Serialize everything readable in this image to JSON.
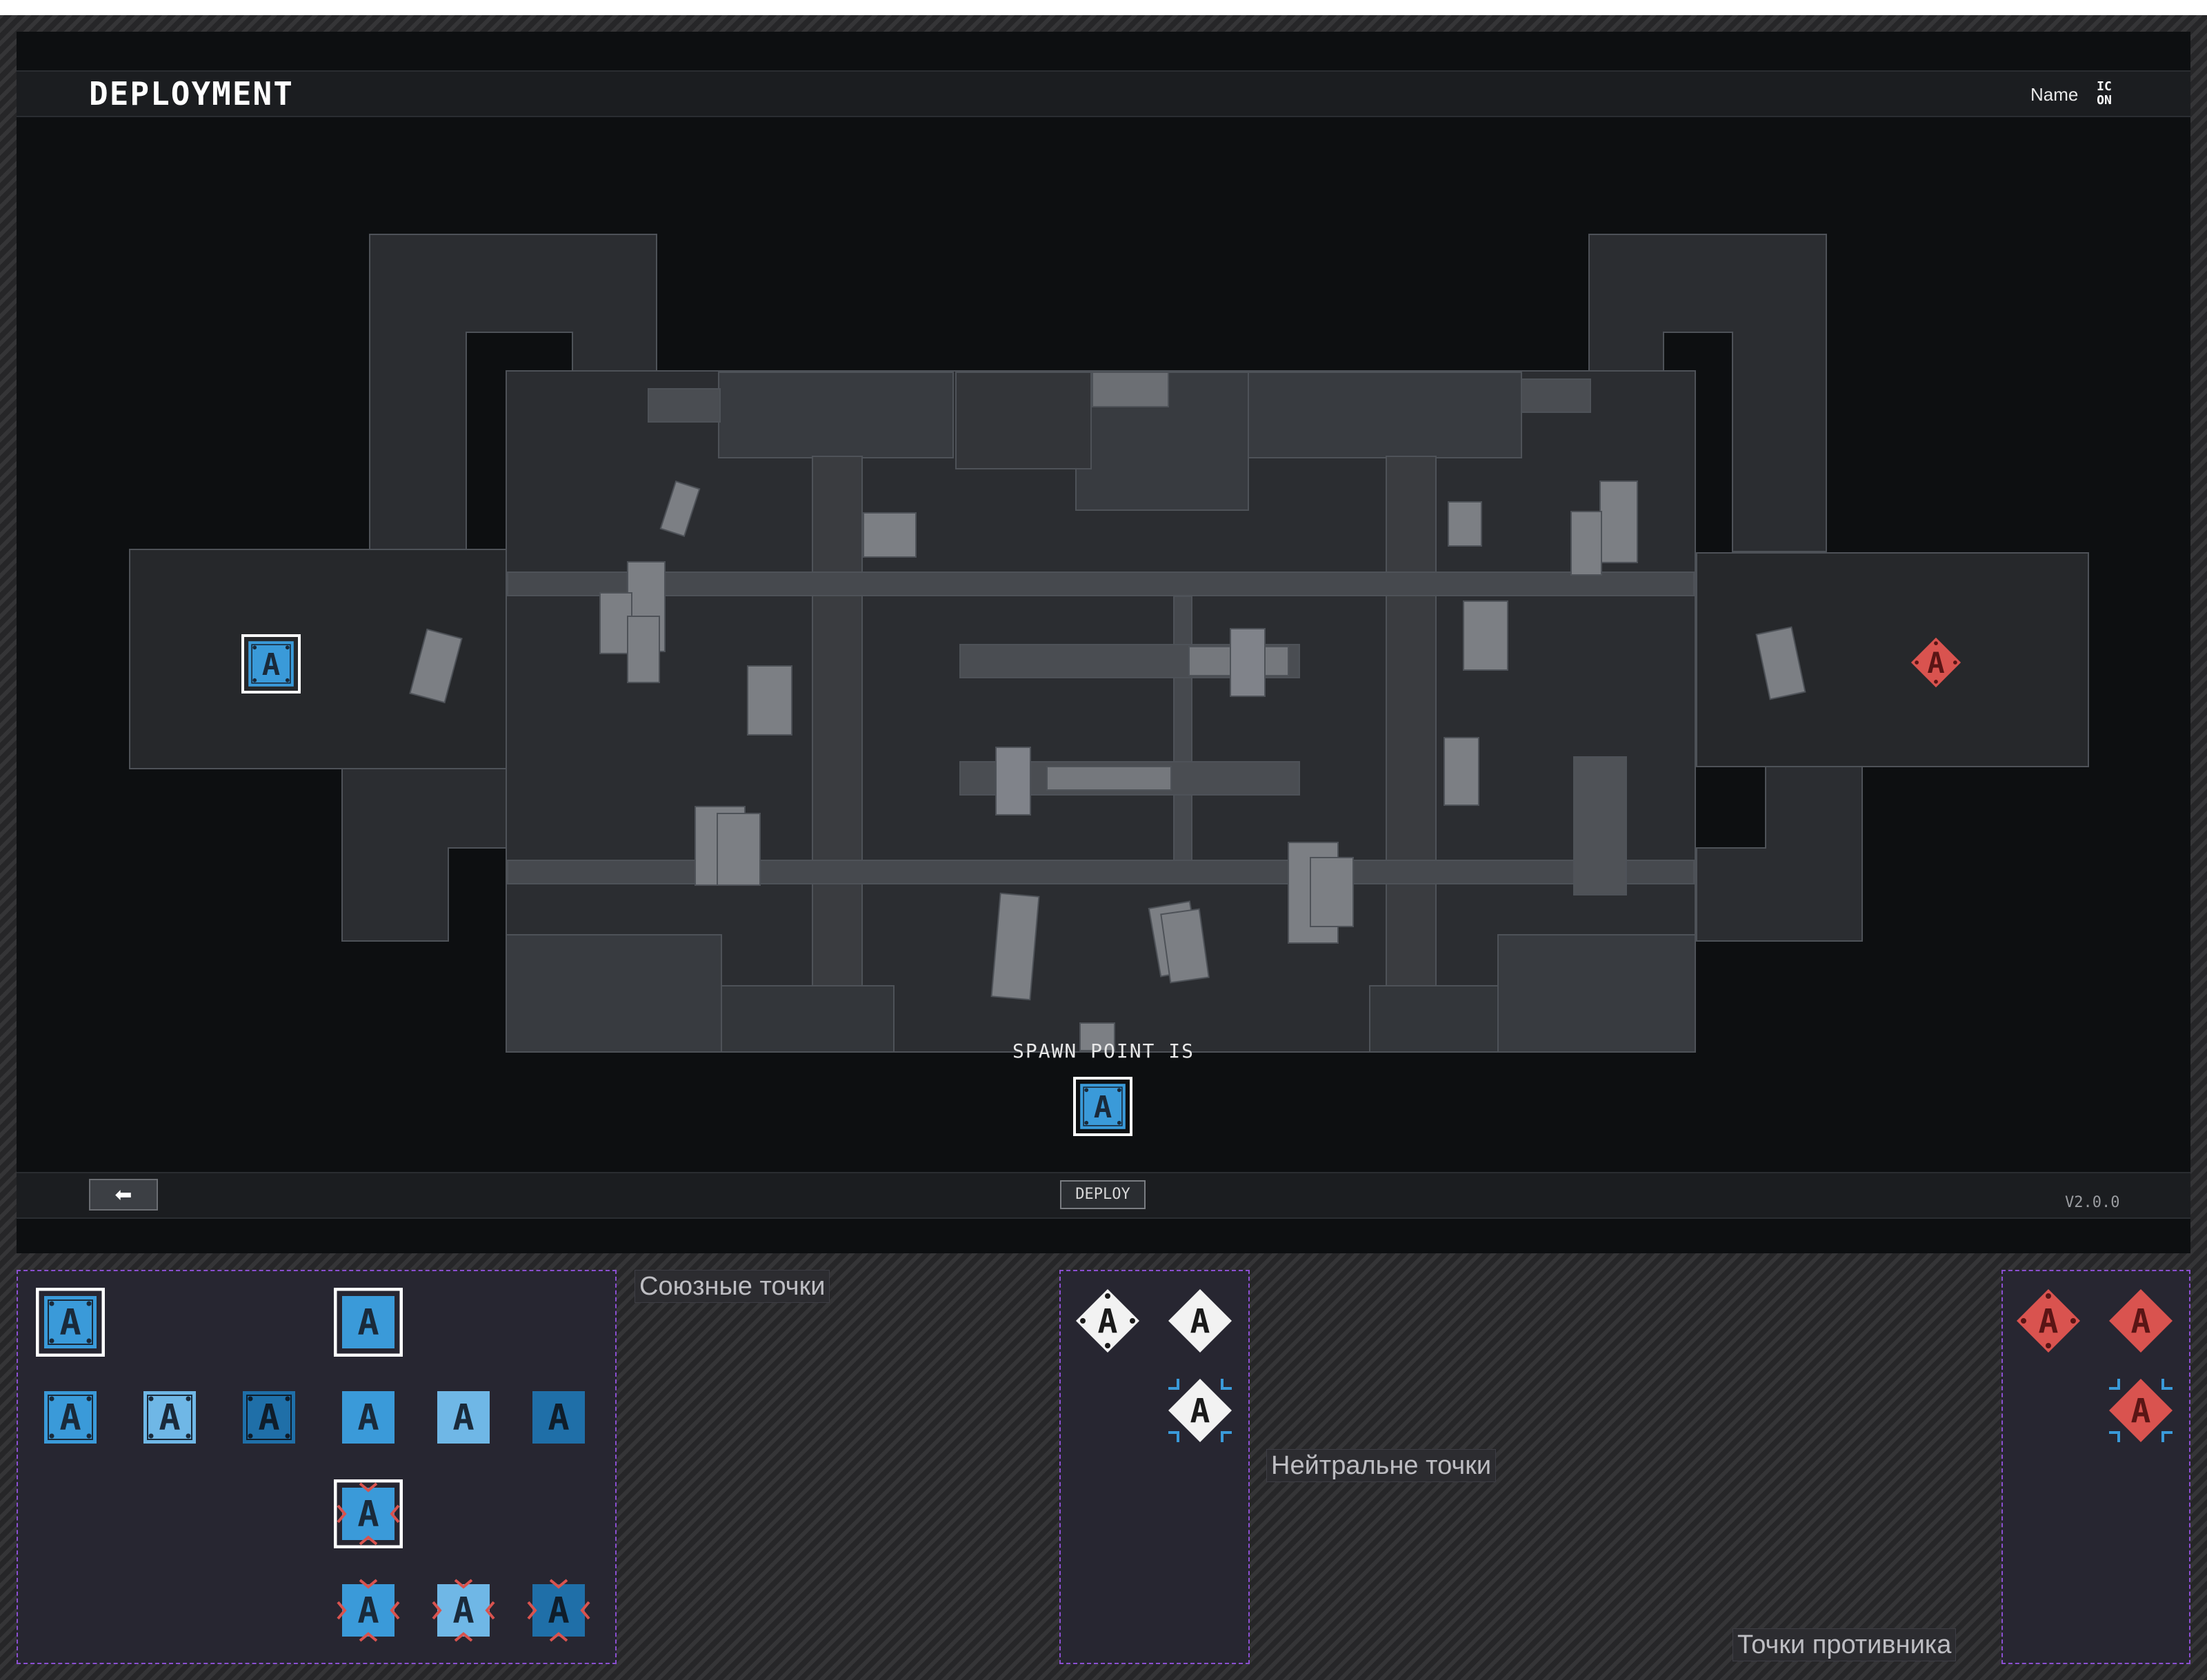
{
  "window": {
    "title": "DEPLOYMENT",
    "name_label": "Name",
    "icon_badge": "IC ON",
    "spawn_label": "SPAWN POINT IS",
    "deploy_label": "DEPLOY",
    "back_icon": "arrow-left-icon",
    "version": "V2.0.0"
  },
  "map": {
    "allied_point_letter": "A",
    "enemy_point_letter": "A",
    "spawn_point_letter": "A"
  },
  "panels": {
    "allied_label": "Союзные точки",
    "neutral_label": "Нейтральне точки",
    "enemy_label": "Точки противника"
  },
  "icon_letter": "A",
  "colors": {
    "allied_blue": "#3a9ad9",
    "neutral_white": "#f2f2f2",
    "enemy_red": "#d9534f",
    "panel_border": "#8b4fd1"
  }
}
